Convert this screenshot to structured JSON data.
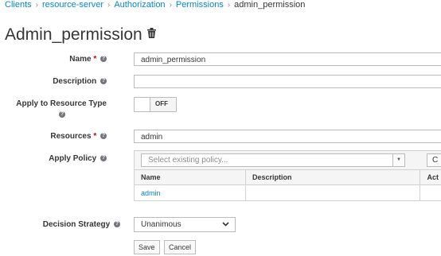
{
  "breadcrumb": {
    "items": [
      "Clients",
      "resource-server",
      "Authorization",
      "Permissions"
    ],
    "current": "admin_permission",
    "separator": "›"
  },
  "page": {
    "title": "Admin_permission",
    "trash_icon": "trash-icon"
  },
  "form": {
    "name": {
      "label": "Name",
      "required_mark": "*",
      "value": "admin_permission"
    },
    "description": {
      "label": "Description",
      "value": ""
    },
    "apply_resource_type": {
      "label": "Apply to Resource Type",
      "toggle_label": "OFF"
    },
    "resources": {
      "label": "Resources",
      "required_mark": "*",
      "value": "admin"
    },
    "apply_policy": {
      "label": "Apply Policy",
      "placeholder": "Select existing policy...",
      "create_button_partial": "C",
      "table": {
        "headers": [
          "Name",
          "Description",
          "Act"
        ],
        "rows": [
          {
            "name": "admin",
            "description": "",
            "actions": ""
          }
        ]
      }
    },
    "decision_strategy": {
      "label": "Decision Strategy",
      "value": "Unanimous"
    }
  },
  "buttons": {
    "save": "Save",
    "cancel": "Cancel"
  },
  "colors": {
    "link": "#0088ce",
    "required": "#cc0000",
    "text": "#363636"
  },
  "help_icon": "?"
}
